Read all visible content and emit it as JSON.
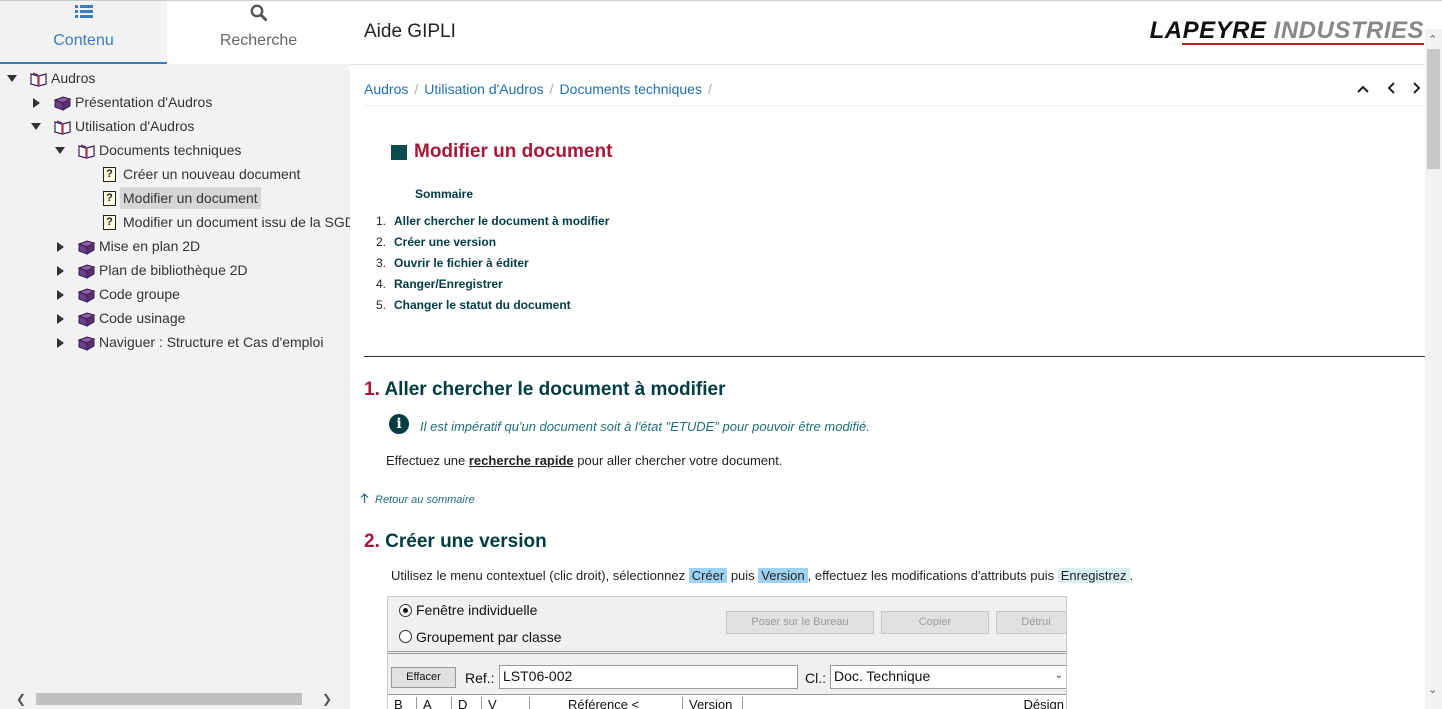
{
  "sidebar": {
    "tabs": [
      {
        "label": "Contenu",
        "icon": "list-icon",
        "active": true
      },
      {
        "label": "Recherche",
        "icon": "search-icon",
        "active": false
      }
    ],
    "tree": [
      {
        "label": "Audros",
        "level": 0,
        "expanded": true,
        "icon": "open-book-icon"
      },
      {
        "label": "Présentation d'Audros",
        "level": 1,
        "expanded": false,
        "icon": "book-icon"
      },
      {
        "label": "Utilisation d'Audros",
        "level": 1,
        "expanded": true,
        "icon": "open-book-icon"
      },
      {
        "label": "Documents techniques",
        "level": 2,
        "expanded": true,
        "icon": "open-book-icon"
      },
      {
        "label": "Créer un nouveau document",
        "level": 3,
        "icon": "help-page-icon"
      },
      {
        "label": "Modifier un document",
        "level": 3,
        "icon": "help-page-icon",
        "selected": true
      },
      {
        "label": "Modifier un document issu de la SGD",
        "level": 3,
        "icon": "help-page-icon"
      },
      {
        "label": "Mise en plan 2D",
        "level": 2,
        "expanded": false,
        "icon": "book-icon"
      },
      {
        "label": "Plan de bibliothèque 2D",
        "level": 2,
        "expanded": false,
        "icon": "book-icon"
      },
      {
        "label": "Code groupe",
        "level": 2,
        "expanded": false,
        "icon": "book-icon"
      },
      {
        "label": "Code usinage",
        "level": 2,
        "expanded": false,
        "icon": "book-icon"
      },
      {
        "label": "Naviguer : Structure et Cas d'emploi",
        "level": 2,
        "expanded": false,
        "icon": "book-icon"
      }
    ]
  },
  "header": {
    "title": "Aide GIPLI",
    "brand_part1": "LAPEYRE",
    "brand_part2": " INDUSTRIES"
  },
  "breadcrumb": {
    "items": [
      "Audros",
      "Utilisation d'Audros",
      "Documents techniques"
    ],
    "sep": "/"
  },
  "nav": {
    "up": "^",
    "prev": "<",
    "next": ">"
  },
  "doc": {
    "title": "Modifier un document",
    "sommaire_label": "Sommaire",
    "toc": [
      {
        "num": "1.",
        "text": "Aller chercher le document à modifier"
      },
      {
        "num": "2.",
        "text": "Créer une version"
      },
      {
        "num": "3.",
        "text": "Ouvrir le fichier à éditer"
      },
      {
        "num": "4.",
        "text": "Ranger/Enregistrer"
      },
      {
        "num": "5.",
        "text": "Changer le statut du document"
      }
    ],
    "section1": {
      "num": "1.",
      "title": "Aller chercher le document à modifier",
      "info": "Il est impératif qu'un document soit à l'état \"ETUDE\" pour pouvoir être modifié.",
      "para_before": "Effectuez une ",
      "para_link": "recherche rapide",
      "para_after": " pour aller chercher votre document."
    },
    "retour": "Retour au sommaire",
    "section2": {
      "num": "2.",
      "title": "Créer une version",
      "p1": "Utilisez le menu contextuel (clic droit), sélectionnez ",
      "tag1": "Créer",
      "p2": " puis ",
      "tag2": "Version",
      "p3": ", effectuez les modifications d'attributs puis ",
      "tag3": "Enregistrez",
      "p4": "."
    }
  },
  "shot": {
    "radio1": "Fenêtre individuelle",
    "radio2": "Groupement par classe",
    "btn_bureau": "Poser sur le Bureau",
    "btn_copier": "Copier",
    "btn_detruire": "Détrui",
    "btn_effacer": "Effacer",
    "ref_label": "Ref.:",
    "ref_value": "LST06-002",
    "cl_label": "Cl.:",
    "cl_value": "Doc. Technique",
    "cols": [
      "B",
      "A",
      "D",
      "V",
      "Référence <",
      "Version",
      "Désign"
    ]
  }
}
